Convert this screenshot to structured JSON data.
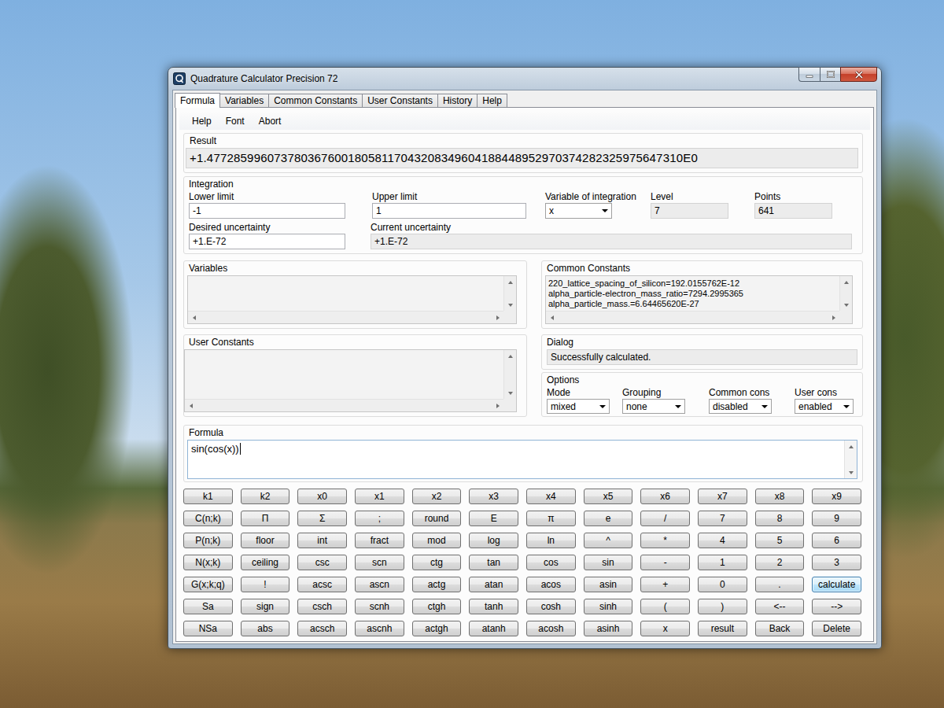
{
  "window": {
    "title": "Quadrature Calculator Precision 72"
  },
  "tabs": [
    {
      "label": "Formula",
      "selected": true
    },
    {
      "label": "Variables",
      "selected": false
    },
    {
      "label": "Common Constants",
      "selected": false
    },
    {
      "label": "User Constants",
      "selected": false
    },
    {
      "label": "History",
      "selected": false
    },
    {
      "label": "Help",
      "selected": false
    }
  ],
  "menu": [
    "Help",
    "Font",
    "Abort"
  ],
  "result": {
    "label": "Result",
    "value": "+1.47728599607378036760018058117043208349604188448952970374282325975647310E0"
  },
  "integration": {
    "label": "Integration",
    "top_fields": [
      {
        "label": "Lower limit",
        "value": "-1",
        "kind": "input"
      },
      {
        "label": "Upper limit",
        "value": "1",
        "kind": "input"
      },
      {
        "label": "Variable of integration",
        "value": "x",
        "kind": "select"
      },
      {
        "label": "Level",
        "value": "7",
        "kind": "readonly"
      },
      {
        "label": "Points",
        "value": "641",
        "kind": "readonly"
      }
    ],
    "bottom_fields": [
      {
        "label": "Desired uncertainty",
        "value": "+1.E-72",
        "kind": "input"
      },
      {
        "label": "Current uncertainty",
        "value": "+1.E-72",
        "kind": "readonly"
      }
    ]
  },
  "variables": {
    "label": "Variables",
    "items": []
  },
  "common_constants": {
    "label": "Common Constants",
    "items": [
      "220_lattice_spacing_of_silicon=192.0155762E-12",
      "alpha_particle-electron_mass_ratio=7294.2995365",
      "alpha_particle_mass.=6.64465620E-27"
    ]
  },
  "user_constants": {
    "label": "User Constants",
    "items": []
  },
  "dialog": {
    "label": "Dialog",
    "message": "Successfully calculated."
  },
  "options": {
    "label": "Options",
    "items": [
      {
        "label": "Mode",
        "value": "mixed"
      },
      {
        "label": "Grouping",
        "value": "none"
      },
      {
        "label": "Common cons",
        "value": "disabled"
      },
      {
        "label": "User cons",
        "value": "enabled"
      }
    ]
  },
  "formula": {
    "label": "Formula",
    "text": "sin(cos(x))"
  },
  "keypad": [
    [
      {
        "label": "k1",
        "focused": false
      },
      {
        "label": "k2",
        "focused": false
      },
      {
        "label": "x0",
        "focused": false
      },
      {
        "label": "x1",
        "focused": false
      },
      {
        "label": "x2",
        "focused": false
      },
      {
        "label": "x3",
        "focused": false
      },
      {
        "label": "x4",
        "focused": false
      },
      {
        "label": "x5",
        "focused": false
      },
      {
        "label": "x6",
        "focused": false
      },
      {
        "label": "x7",
        "focused": false
      },
      {
        "label": "x8",
        "focused": false
      },
      {
        "label": "x9",
        "focused": false
      }
    ],
    [
      {
        "label": "C(n;k)",
        "focused": false
      },
      {
        "label": "Π",
        "focused": false
      },
      {
        "label": "Σ",
        "focused": false
      },
      {
        "label": ";",
        "focused": false
      },
      {
        "label": "round",
        "focused": false
      },
      {
        "label": "E",
        "focused": false
      },
      {
        "label": "π",
        "focused": false
      },
      {
        "label": "e",
        "focused": false
      },
      {
        "label": "/",
        "focused": false
      },
      {
        "label": "7",
        "focused": false
      },
      {
        "label": "8",
        "focused": false
      },
      {
        "label": "9",
        "focused": false
      }
    ],
    [
      {
        "label": "P(n;k)",
        "focused": false
      },
      {
        "label": "floor",
        "focused": false
      },
      {
        "label": "int",
        "focused": false
      },
      {
        "label": "fract",
        "focused": false
      },
      {
        "label": "mod",
        "focused": false
      },
      {
        "label": "log",
        "focused": false
      },
      {
        "label": "ln",
        "focused": false
      },
      {
        "label": "^",
        "focused": false
      },
      {
        "label": "*",
        "focused": false
      },
      {
        "label": "4",
        "focused": false
      },
      {
        "label": "5",
        "focused": false
      },
      {
        "label": "6",
        "focused": false
      }
    ],
    [
      {
        "label": "N(x;k)",
        "focused": false
      },
      {
        "label": "ceiling",
        "focused": false
      },
      {
        "label": "csc",
        "focused": false
      },
      {
        "label": "scn",
        "focused": false
      },
      {
        "label": "ctg",
        "focused": false
      },
      {
        "label": "tan",
        "focused": false
      },
      {
        "label": "cos",
        "focused": false
      },
      {
        "label": "sin",
        "focused": false
      },
      {
        "label": "-",
        "focused": false
      },
      {
        "label": "1",
        "focused": false
      },
      {
        "label": "2",
        "focused": false
      },
      {
        "label": "3",
        "focused": false
      }
    ],
    [
      {
        "label": "G(x;k;q)",
        "focused": false
      },
      {
        "label": "!",
        "focused": false
      },
      {
        "label": "acsc",
        "focused": false
      },
      {
        "label": "ascn",
        "focused": false
      },
      {
        "label": "actg",
        "focused": false
      },
      {
        "label": "atan",
        "focused": false
      },
      {
        "label": "acos",
        "focused": false
      },
      {
        "label": "asin",
        "focused": false
      },
      {
        "label": "+",
        "focused": false
      },
      {
        "label": "0",
        "focused": false
      },
      {
        "label": ".",
        "focused": false
      },
      {
        "label": "calculate",
        "focused": true
      }
    ],
    [
      {
        "label": "Sa",
        "focused": false
      },
      {
        "label": "sign",
        "focused": false
      },
      {
        "label": "csch",
        "focused": false
      },
      {
        "label": "scnh",
        "focused": false
      },
      {
        "label": "ctgh",
        "focused": false
      },
      {
        "label": "tanh",
        "focused": false
      },
      {
        "label": "cosh",
        "focused": false
      },
      {
        "label": "sinh",
        "focused": false
      },
      {
        "label": "(",
        "focused": false
      },
      {
        "label": ")",
        "focused": false
      },
      {
        "label": "<--",
        "focused": false
      },
      {
        "label": "-->",
        "focused": false
      }
    ],
    [
      {
        "label": "NSa",
        "focused": false
      },
      {
        "label": "abs",
        "focused": false
      },
      {
        "label": "acsch",
        "focused": false
      },
      {
        "label": "ascnh",
        "focused": false
      },
      {
        "label": "actgh",
        "focused": false
      },
      {
        "label": "atanh",
        "focused": false
      },
      {
        "label": "acosh",
        "focused": false
      },
      {
        "label": "asinh",
        "focused": false
      },
      {
        "label": "x",
        "focused": false
      },
      {
        "label": "result",
        "focused": false
      },
      {
        "label": "Back",
        "focused": false
      },
      {
        "label": "Delete",
        "focused": false
      }
    ]
  ]
}
